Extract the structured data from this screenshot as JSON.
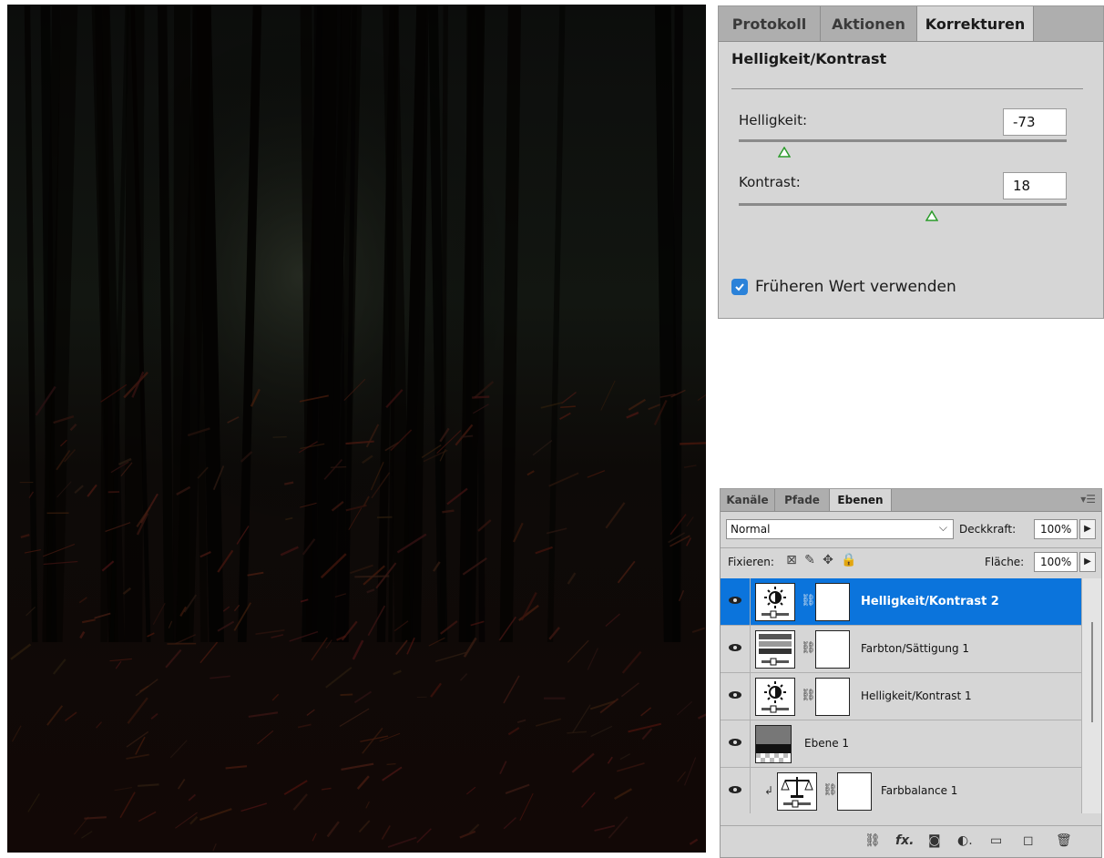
{
  "adjustments_panel": {
    "tabs": [
      {
        "label": "Protokoll",
        "active": false
      },
      {
        "label": "Aktionen",
        "active": false
      },
      {
        "label": "Korrekturen",
        "active": true
      }
    ],
    "title": "Helligkeit/Kontrast",
    "brightness": {
      "label": "Helligkeit:",
      "value": "-73",
      "slider_fraction": 0.14
    },
    "contrast": {
      "label": "Kontrast:",
      "value": "18",
      "slider_fraction": 0.59
    },
    "legacy_checkbox": {
      "label": "Früheren Wert verwenden",
      "checked": true
    }
  },
  "layers_panel": {
    "tabs": [
      {
        "label": "Kanäle",
        "active": false
      },
      {
        "label": "Pfade",
        "active": false
      },
      {
        "label": "Ebenen",
        "active": true
      }
    ],
    "menu_icon": "panel-menu-icon",
    "blend_mode": "Normal",
    "opacity_label": "Deckkraft:",
    "opacity_value": "100%",
    "lock_label": "Fixieren:",
    "fill_label": "Fläche:",
    "fill_value": "100%",
    "layers": [
      {
        "name": "Helligkeit/Kontrast 2",
        "type": "brightness-contrast",
        "selected": true,
        "has_mask": true,
        "clipped": false
      },
      {
        "name": "Farbton/Sättigung 1",
        "type": "hue-saturation",
        "selected": false,
        "has_mask": true,
        "clipped": false
      },
      {
        "name": "Helligkeit/Kontrast 1",
        "type": "brightness-contrast",
        "selected": false,
        "has_mask": true,
        "clipped": false
      },
      {
        "name": "Ebene 1",
        "type": "pixel",
        "selected": false,
        "has_mask": false,
        "clipped": false
      },
      {
        "name": "Farbbalance 1",
        "type": "color-balance",
        "selected": false,
        "has_mask": true,
        "clipped": true
      }
    ]
  },
  "colors": {
    "panel_bg": "#d6d6d6",
    "selection": "#0b74dc",
    "canvas_bg": "#050302"
  }
}
